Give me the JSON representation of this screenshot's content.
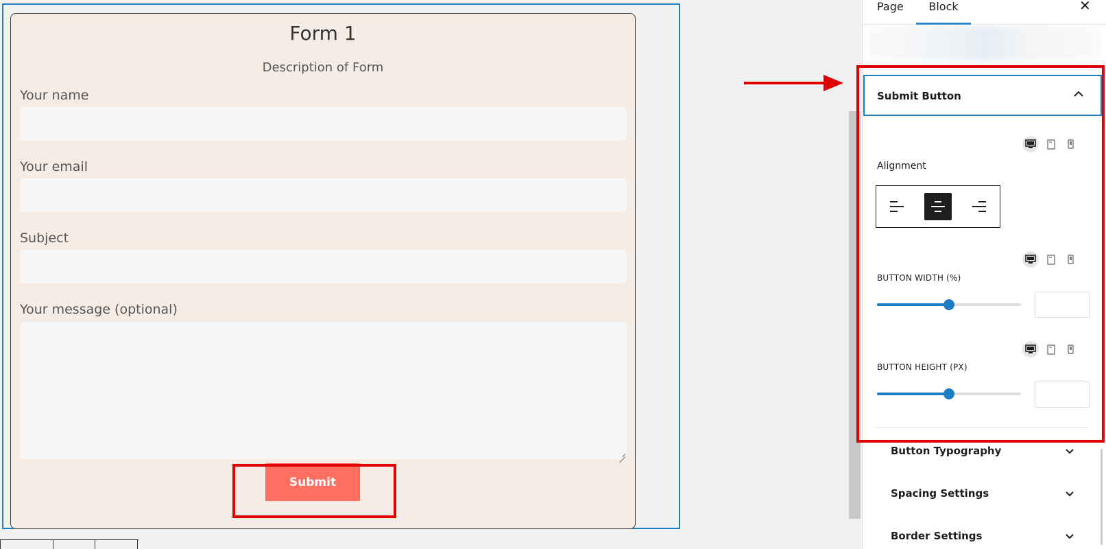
{
  "form": {
    "title": "Form 1",
    "description": "Description of Form",
    "fields": [
      {
        "label": "Your name"
      },
      {
        "label": "Your email"
      },
      {
        "label": "Subject"
      },
      {
        "label": "Your message (optional)"
      }
    ],
    "submit_label": "Submit",
    "colors": {
      "card_bg": "#f5ece6",
      "submit_bg": "#ff6f61",
      "block_outline": "#1d80c1",
      "annotation": "#e00000"
    }
  },
  "sidebar": {
    "tabs": [
      {
        "label": "Page"
      },
      {
        "label": "Block",
        "active": true
      }
    ],
    "close_glyph": "✕",
    "panel": {
      "title": "Submit Button",
      "expanded": true,
      "alignment": {
        "label": "Alignment",
        "selected": "center",
        "options": [
          "left",
          "center",
          "right"
        ]
      },
      "button_width": {
        "label": "BUTTON WIDTH (%)",
        "slider_fraction": 0.5,
        "value": ""
      },
      "button_height": {
        "label": "BUTTON HEIGHT (PX)",
        "slider_fraction": 0.5,
        "value": ""
      }
    },
    "collapsed_sections": [
      {
        "label": "Button Typography"
      },
      {
        "label": "Spacing Settings"
      },
      {
        "label": "Border Settings"
      }
    ],
    "accent": "#1d7dc4"
  },
  "icons": {
    "device_desktop": "desktop-icon",
    "device_tablet": "tablet-icon",
    "device_mobile": "mobile-icon"
  }
}
